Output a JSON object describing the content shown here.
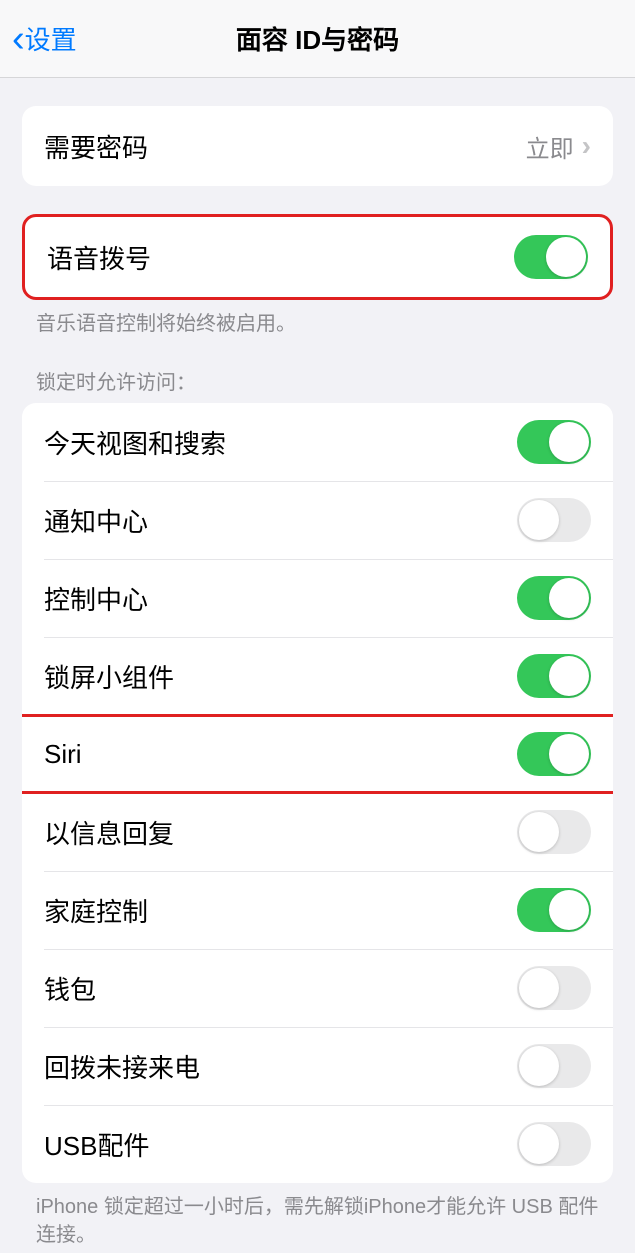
{
  "header": {
    "back_label": "设置",
    "title": "面容 ID与密码"
  },
  "passcode": {
    "label": "需要密码",
    "value": "立即"
  },
  "voice_dial": {
    "label": "语音拨号",
    "on": true,
    "footer": "音乐语音控制将始终被启用。"
  },
  "locked_access": {
    "header": "锁定时允许访问：",
    "items": [
      {
        "label": "今天视图和搜索",
        "on": true
      },
      {
        "label": "通知中心",
        "on": false
      },
      {
        "label": "控制中心",
        "on": true
      },
      {
        "label": "锁屏小组件",
        "on": true
      },
      {
        "label": "Siri",
        "on": true
      },
      {
        "label": "以信息回复",
        "on": false
      },
      {
        "label": "家庭控制",
        "on": true
      },
      {
        "label": "钱包",
        "on": false
      },
      {
        "label": "回拨未接来电",
        "on": false
      },
      {
        "label": "USB配件",
        "on": false
      }
    ],
    "footer": "iPhone 锁定超过一小时后，需先解锁iPhone才能允许 USB 配件连接。"
  }
}
